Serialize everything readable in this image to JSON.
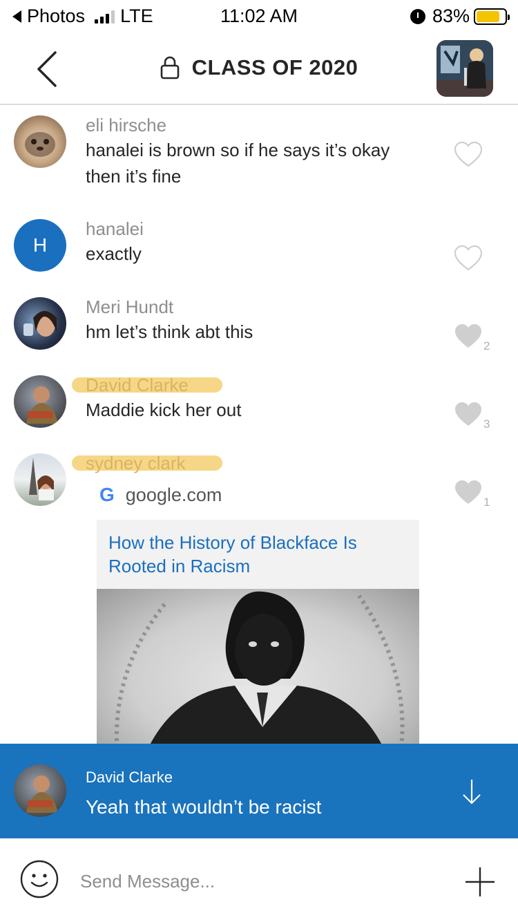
{
  "status_bar": {
    "back_app": "Photos",
    "network": "LTE",
    "time": "11:02 AM",
    "battery": "83%",
    "battery_level": 0.83,
    "battery_color": "#f5c400"
  },
  "header": {
    "title": "CLASS OF 2020",
    "back_icon": "chevron-left-icon",
    "lock_icon": "lock-icon"
  },
  "messages": [
    {
      "author": "eli hirsche",
      "text": "hanalei is brown so if he says it’s okay then it’s fine",
      "likes": ""
    },
    {
      "author": "hanalei",
      "avatar_initial": "H",
      "text": "exactly",
      "likes": ""
    },
    {
      "author": "Meri Hundt",
      "text": "hm let’s think abt this",
      "likes": "2"
    },
    {
      "author": "David Clarke",
      "text": "Maddie kick her out",
      "likes": "3"
    },
    {
      "author": "sydney clark",
      "text": "",
      "likes": "1",
      "link": {
        "source": "google.com",
        "title": "How the History of Blackface Is Rooted in Racism"
      }
    }
  ],
  "reply": {
    "author": "David Clarke",
    "text": "Yeah that wouldn’t be racist"
  },
  "input": {
    "placeholder": "Send Message..."
  },
  "colors": {
    "accent": "#1a73bd",
    "highlight": "#f5d37a",
    "link": "#1a6fbf"
  }
}
